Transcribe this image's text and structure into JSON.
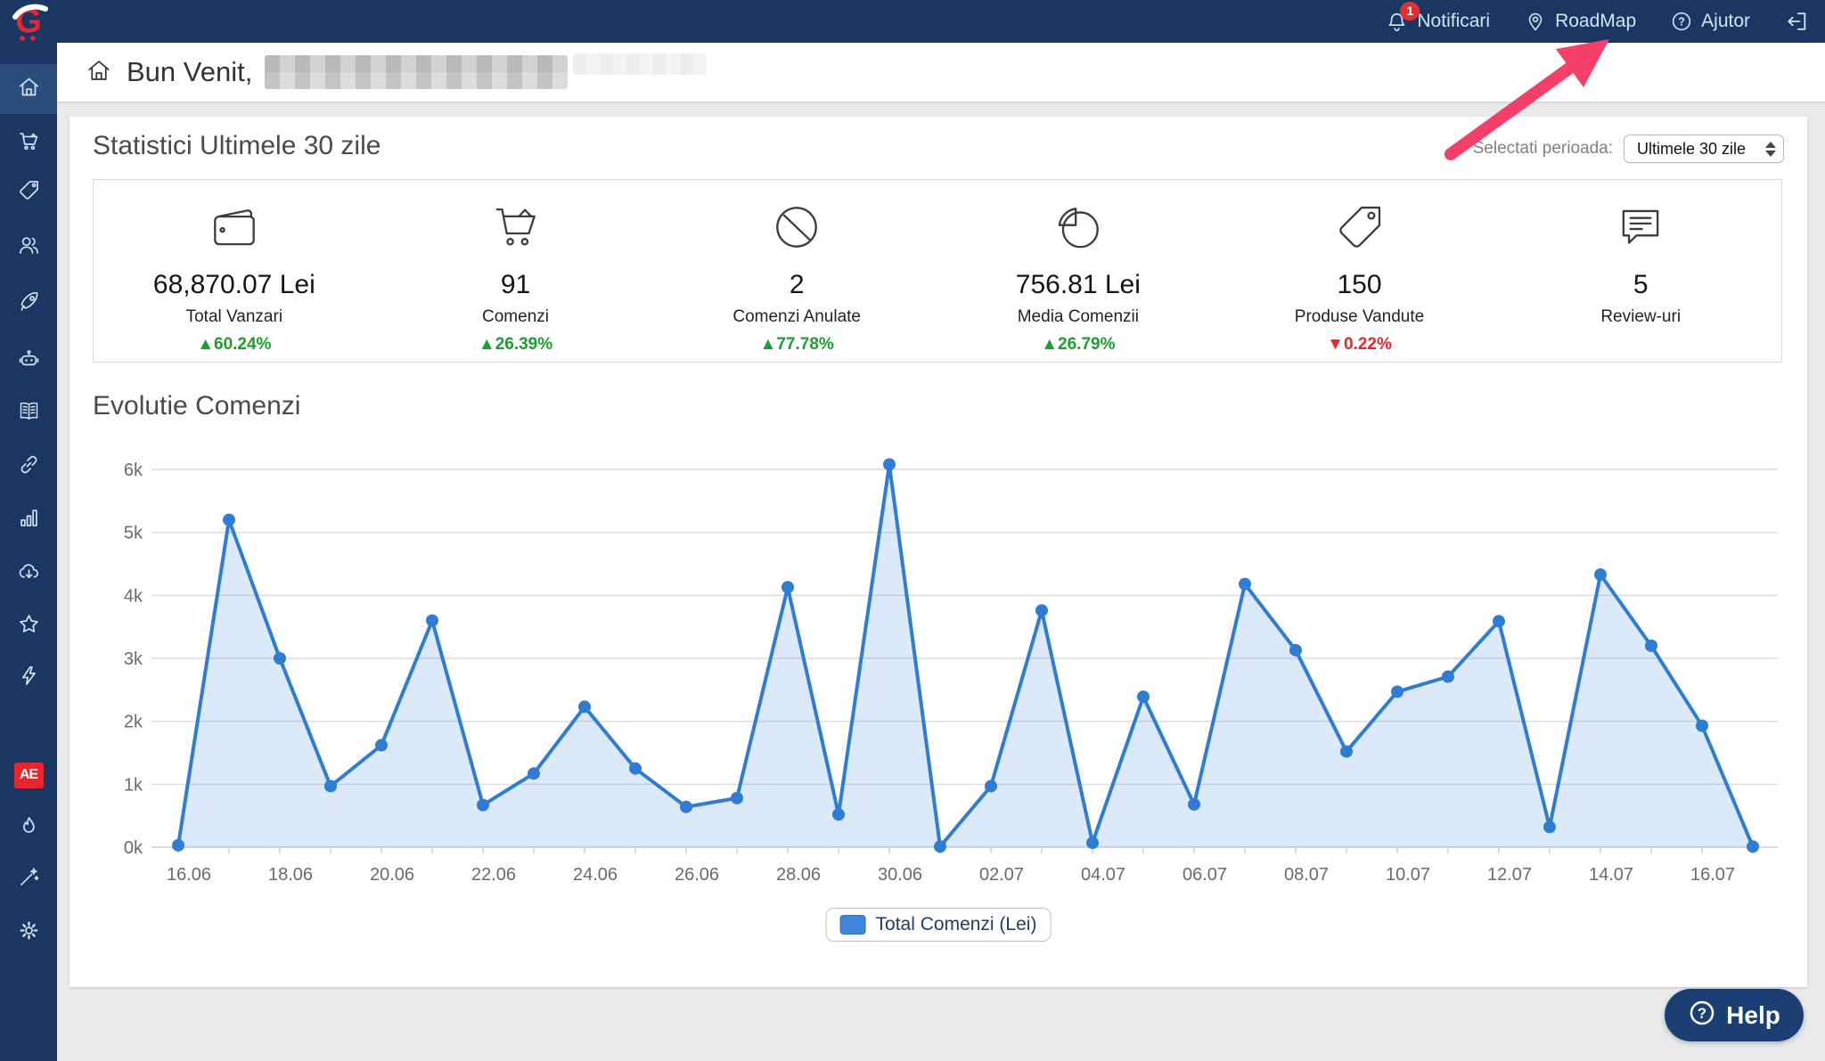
{
  "topbar": {
    "notifications_label": "Notificari",
    "notifications_count": "1",
    "roadmap_label": "RoadMap",
    "help_label": "Ajutor",
    "icons": [
      "bell-icon",
      "map-pin-icon",
      "question-circle-icon",
      "logout-icon"
    ]
  },
  "sidebar": {
    "icons": [
      "home-icon",
      "cart-icon",
      "tag-icon",
      "users-icon",
      "rocket-icon",
      "robot-icon",
      "book-icon",
      "link-icon",
      "bar-chart-icon",
      "cloud-download-icon",
      "star-icon",
      "lightning-icon",
      "aliexpress-badge",
      "flame-icon",
      "magic-wand-icon",
      "gear-icon"
    ],
    "aliexpress_label": "AE",
    "active_item": "home"
  },
  "header": {
    "welcome": "Bun Venit,"
  },
  "stats": {
    "title": "Statistici Ultimele 30 zile",
    "period_label": "Selectati perioada:",
    "period_value": "Ultimele 30 zile",
    "cards": [
      {
        "icon": "wallet-icon",
        "value": "68,870.07 Lei",
        "label": "Total Vanzari",
        "arrow": "▲",
        "delta": "60.24%",
        "direction": "up"
      },
      {
        "icon": "cart-icon",
        "value": "91",
        "label": "Comenzi",
        "arrow": "▲",
        "delta": "26.39%",
        "direction": "up"
      },
      {
        "icon": "ban-icon",
        "value": "2",
        "label": "Comenzi Anulate",
        "arrow": "▲",
        "delta": "77.78%",
        "direction": "up"
      },
      {
        "icon": "pie-icon",
        "value": "756.81 Lei",
        "label": "Media Comenzii",
        "arrow": "▲",
        "delta": "26.79%",
        "direction": "up"
      },
      {
        "icon": "tag-icon",
        "value": "150",
        "label": "Produse Vandute",
        "arrow": "▼",
        "delta": "0.22%",
        "direction": "down"
      },
      {
        "icon": "comment-icon",
        "value": "5",
        "label": "Review-uri",
        "arrow": "",
        "delta": "",
        "direction": "none"
      }
    ],
    "up_color": "#18a12d",
    "down_color": "#ee2424"
  },
  "chart_section_title": "Evolutie Comenzi",
  "chart_data": {
    "type": "area",
    "title": "Evolutie Comenzi",
    "x": [
      "16.06",
      "17.06",
      "18.06",
      "19.06",
      "20.06",
      "21.06",
      "22.06",
      "23.06",
      "24.06",
      "25.06",
      "26.06",
      "27.06",
      "28.06",
      "29.06",
      "30.06",
      "01.07",
      "02.07",
      "03.07",
      "04.07",
      "05.07",
      "06.07",
      "07.07",
      "08.07",
      "09.07",
      "10.07",
      "11.07",
      "12.07",
      "13.07",
      "14.07",
      "15.07",
      "16.07",
      "17.07"
    ],
    "x_tick_labels": [
      "16.06",
      "18.06",
      "20.06",
      "22.06",
      "24.06",
      "26.06",
      "28.06",
      "30.06",
      "02.07",
      "04.07",
      "06.07",
      "08.07",
      "10.07",
      "12.07",
      "14.07",
      "16.07"
    ],
    "series": [
      {
        "name": "Total Comenzi (Lei)",
        "values": [
          30,
          5200,
          3000,
          970,
          1620,
          3600,
          670,
          1170,
          2230,
          1250,
          640,
          780,
          4130,
          520,
          6080,
          10,
          970,
          3760,
          70,
          2390,
          680,
          4180,
          3130,
          1520,
          2470,
          2710,
          3590,
          320,
          4330,
          3200,
          1930,
          10
        ]
      }
    ],
    "ylim": [
      0,
      6000
    ],
    "y_ticks": [
      "0k",
      "1k",
      "2k",
      "3k",
      "4k",
      "5k",
      "6k"
    ],
    "grid": true,
    "legend_position": "bottom",
    "line_color": "#2e7cd3",
    "fill_color": "rgba(62,134,216,0.18)",
    "axis_label_color": "#6b6b6b"
  },
  "help_button": {
    "label": "Help",
    "icon": "question-circle-icon"
  },
  "annotation": {
    "type": "arrow",
    "color": "#f43f68",
    "points_at": "RoadMap"
  }
}
